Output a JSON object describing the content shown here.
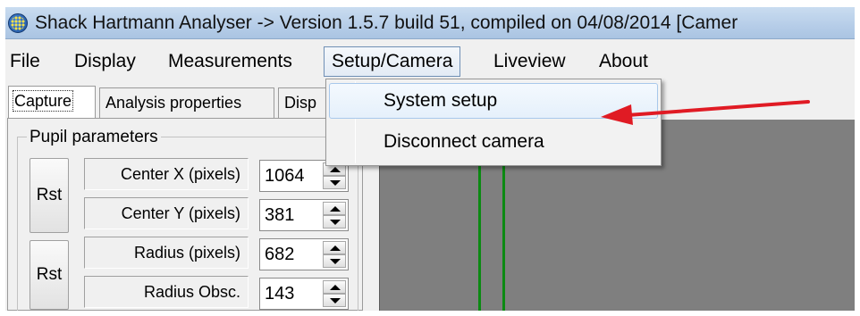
{
  "window": {
    "title": "Shack Hartmann Analyser ->  Version  1.5.7 build 51, compiled on 04/08/2014 [Camer"
  },
  "menubar": {
    "items": [
      {
        "label": "File"
      },
      {
        "label": "Display"
      },
      {
        "label": "Measurements"
      },
      {
        "label": "Setup/Camera"
      },
      {
        "label": "Liveview"
      },
      {
        "label": "About"
      }
    ]
  },
  "dropdown": {
    "items": [
      {
        "label": "System setup"
      },
      {
        "label": "Disconnect camera"
      }
    ]
  },
  "tabs": [
    {
      "label": "Capture"
    },
    {
      "label": "Analysis properties"
    },
    {
      "label": "Disp"
    }
  ],
  "pupil": {
    "group_label": "Pupil parameters",
    "rst_label": "Rst",
    "fields": [
      {
        "label": "Center X (pixels)",
        "value": "1064"
      },
      {
        "label": "Center Y (pixels)",
        "value": "381"
      },
      {
        "label": "Radius (pixels)",
        "value": "682"
      },
      {
        "label": "Radius Obsc.",
        "value": "143"
      }
    ]
  },
  "colors": {
    "annotation_arrow": "#e01b24",
    "guide_lines": "#0b8a12",
    "viewer_bg": "#7f7f7f"
  },
  "icons": {
    "app": "app-icon",
    "spin_up": "arrow-up-icon",
    "spin_down": "arrow-down-icon"
  }
}
